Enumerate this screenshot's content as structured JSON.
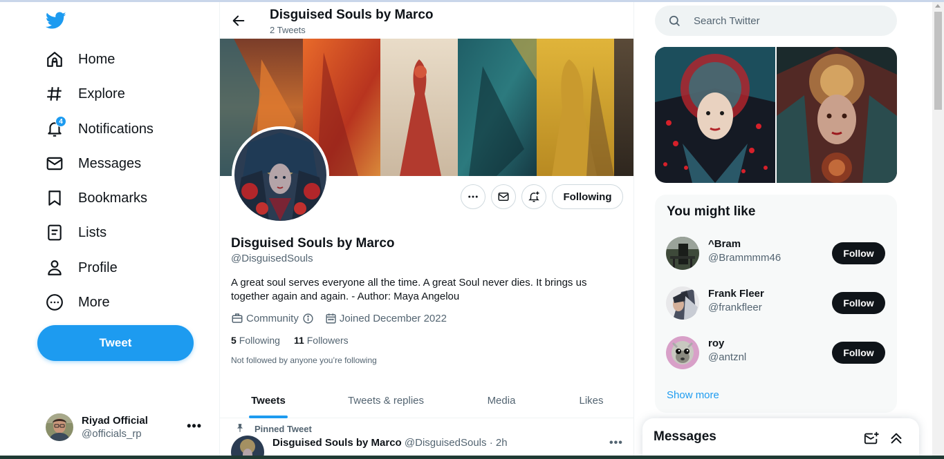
{
  "nav": {
    "items": [
      {
        "label": "Home",
        "icon": "home-icon"
      },
      {
        "label": "Explore",
        "icon": "hashtag-icon"
      },
      {
        "label": "Notifications",
        "icon": "bell-icon",
        "badge": "4"
      },
      {
        "label": "Messages",
        "icon": "envelope-icon"
      },
      {
        "label": "Bookmarks",
        "icon": "bookmark-icon"
      },
      {
        "label": "Lists",
        "icon": "list-icon"
      },
      {
        "label": "Profile",
        "icon": "person-icon"
      },
      {
        "label": "More",
        "icon": "more-circle-icon"
      }
    ],
    "tweet_button": "Tweet"
  },
  "account": {
    "name": "Riyad Official",
    "handle": "@officials_rp",
    "more": "•••"
  },
  "header": {
    "title": "Disguised Souls by Marco",
    "subtitle": "2 Tweets"
  },
  "profile": {
    "name": "Disguised Souls by Marco",
    "handle": "@DisguisedSouls",
    "bio": "A great soul serves everyone all the time. A great Soul never dies. It brings us together again and again. - Author: Maya Angelou",
    "category": "Community",
    "joined": "Joined December 2022",
    "following_count": "5",
    "following_label": "Following",
    "followers_count": "11",
    "followers_label": "Followers",
    "not_followed": "Not followed by anyone you’re following",
    "following_button": "Following",
    "more_button": "•••"
  },
  "tabs": [
    {
      "label": "Tweets",
      "active": true
    },
    {
      "label": "Tweets & replies",
      "active": false
    },
    {
      "label": "Media",
      "active": false
    },
    {
      "label": "Likes",
      "active": false
    }
  ],
  "pinned_tweet": {
    "pinned_label": "Pinned Tweet",
    "author": "Disguised Souls by Marco",
    "handle": "@DisguisedSouls",
    "time": "· 2h",
    "more": "•••"
  },
  "search": {
    "placeholder": "Search Twitter"
  },
  "who_to_follow": {
    "title": "You might like",
    "users": [
      {
        "name": "^Bram",
        "handle": "@Brammmm46",
        "button": "Follow"
      },
      {
        "name": "Frank Fleer",
        "handle": "@frankfleer",
        "button": "Follow"
      },
      {
        "name": "roy",
        "handle": "@antznl",
        "button": "Follow"
      }
    ],
    "show_more": "Show more"
  },
  "messages_drawer": {
    "title": "Messages"
  },
  "colors": {
    "accent": "#1d9bf0",
    "text": "#0f1419",
    "muted": "#536471"
  }
}
